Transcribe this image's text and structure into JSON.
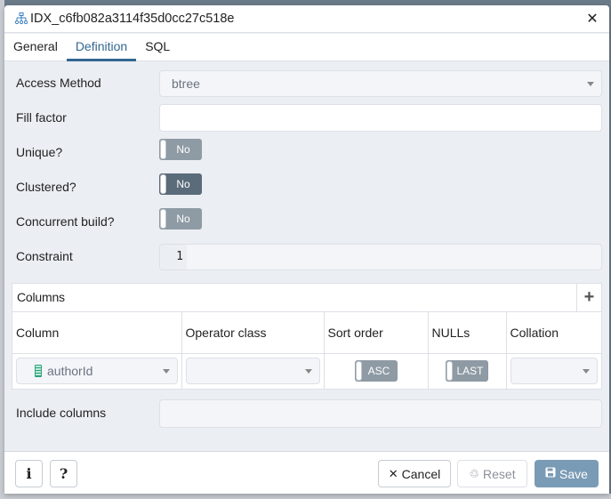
{
  "dialog": {
    "title": "IDX_c6fb082a3114f35d0cc27c518e",
    "title_icon": "index-tree-icon",
    "close_icon": "close-icon"
  },
  "tabs": [
    {
      "label": "General",
      "active": false
    },
    {
      "label": "Definition",
      "active": true
    },
    {
      "label": "SQL",
      "active": false
    }
  ],
  "form": {
    "access_method": {
      "label": "Access Method",
      "value": "btree"
    },
    "fill_factor": {
      "label": "Fill factor",
      "value": ""
    },
    "unique": {
      "label": "Unique?",
      "value": "No"
    },
    "clustered": {
      "label": "Clustered?",
      "value": "No"
    },
    "concurrent_build": {
      "label": "Concurrent build?",
      "value": "No"
    },
    "constraint": {
      "label": "Constraint",
      "line_number": "1",
      "value": ""
    },
    "include_columns": {
      "label": "Include columns",
      "value": ""
    }
  },
  "columns_panel": {
    "title": "Columns",
    "add_icon": "plus-icon",
    "headers": [
      "Column",
      "Operator class",
      "Sort order",
      "NULLs",
      "Collation"
    ],
    "rows": [
      {
        "column": "authorId",
        "operator_class": "",
        "sort_order": "ASC",
        "nulls": "LAST",
        "collation": ""
      }
    ]
  },
  "footer": {
    "info_label": "i",
    "help_label": "?",
    "cancel_label": "Cancel",
    "reset_label": "Reset",
    "save_label": "Save"
  },
  "colors": {
    "accent": "#326690",
    "toggle_off": "#8e9aa4",
    "toggle_focused": "#5a6b7a",
    "save_button": "#7a9bb5"
  }
}
